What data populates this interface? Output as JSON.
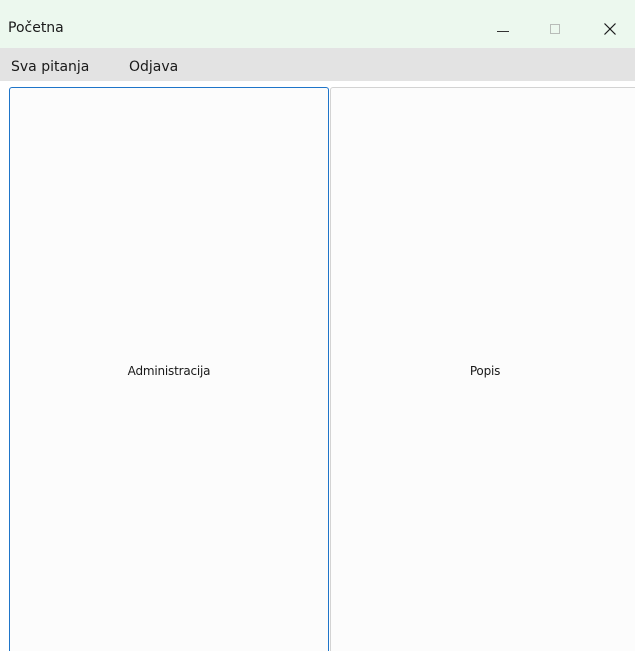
{
  "window": {
    "title": "Početna",
    "controls": {
      "minimize_icon": "minimize-icon",
      "maximize_icon": "maximize-icon",
      "close_icon": "close-icon"
    }
  },
  "menu": {
    "items": [
      {
        "label": "Sva pitanja"
      },
      {
        "label": "Odjava"
      }
    ]
  },
  "buttons": {
    "administracija": "Administracija",
    "popis": "Popis"
  },
  "colors": {
    "titlebar_bg": "#ecf8ee",
    "menubar_bg": "#e3e3e3",
    "focus_border": "#1f75c9",
    "button_border": "#d3d3d3"
  }
}
